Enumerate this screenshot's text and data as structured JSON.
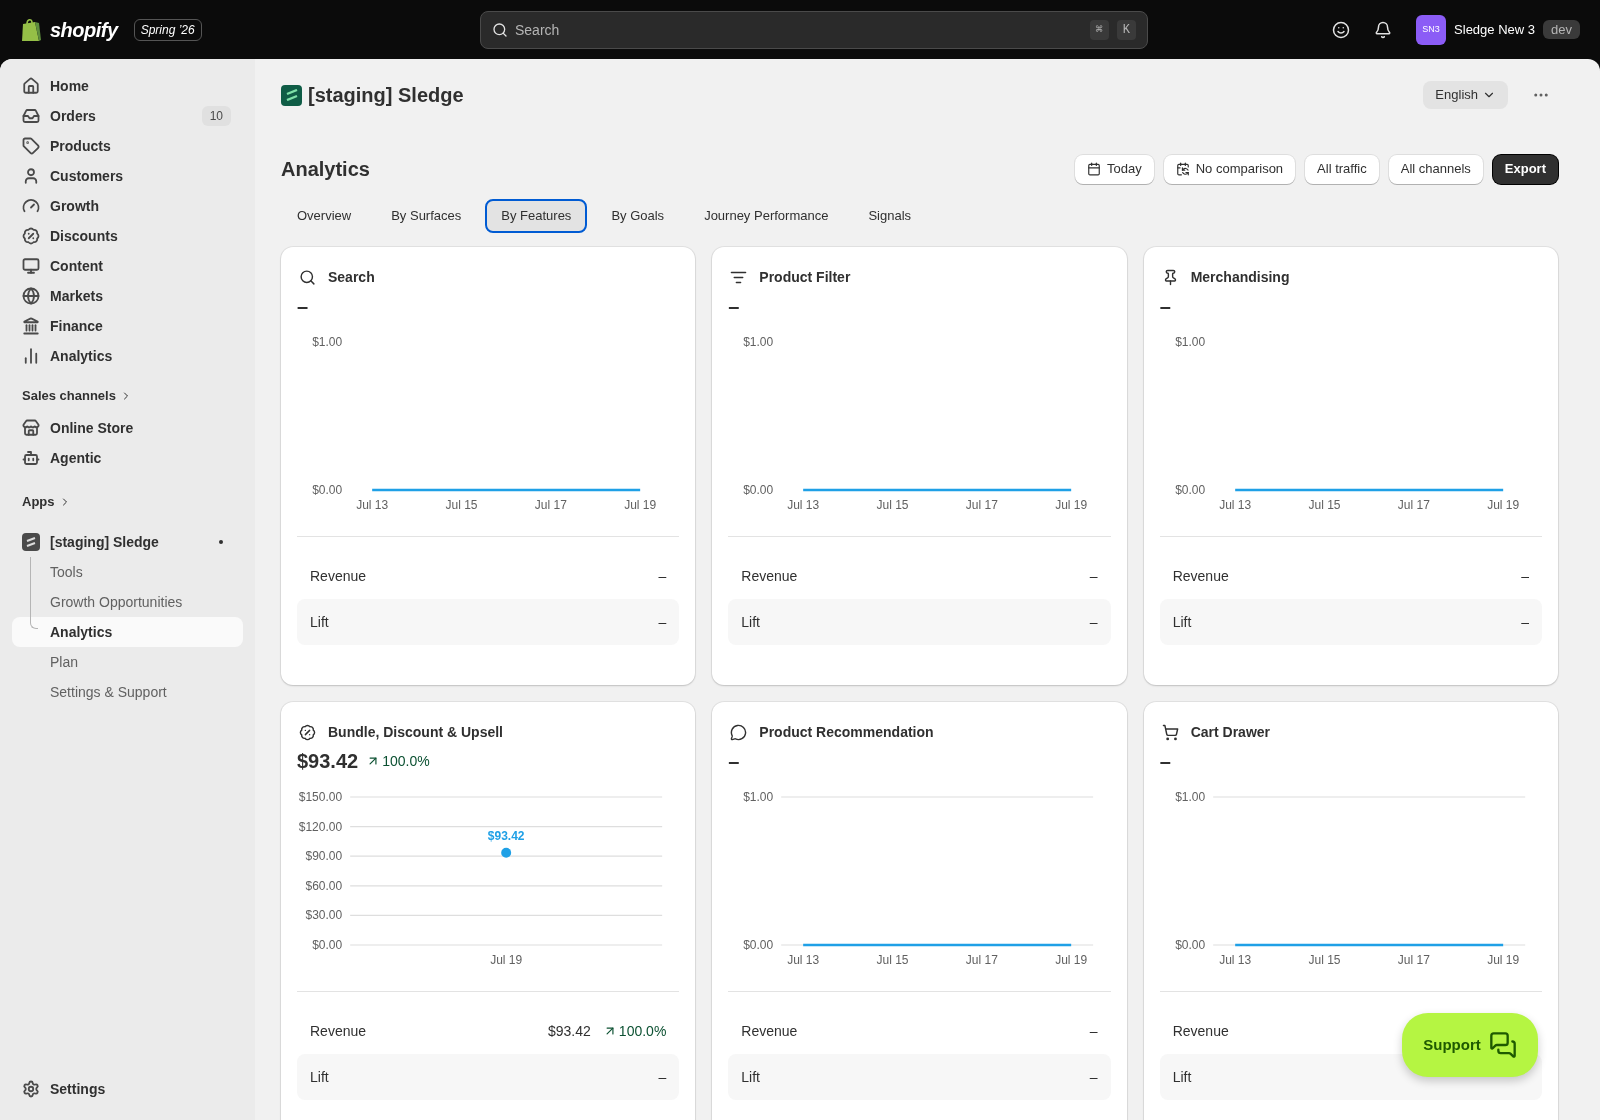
{
  "top_bar": {
    "brand": "shopify",
    "edition": "Spring ’26",
    "search": {
      "placeholder": "Search",
      "shortcut": [
        "⌘",
        "K"
      ]
    },
    "store": {
      "initials": "SN3",
      "name": "Sledge New 3",
      "badge": "dev"
    }
  },
  "sidebar": {
    "items": [
      {
        "label": "Home",
        "selected": false
      },
      {
        "label": "Orders",
        "badge": "10",
        "selected": false
      },
      {
        "label": "Products",
        "selected": false
      },
      {
        "label": "Customers",
        "selected": false
      },
      {
        "label": "Growth",
        "selected": false
      },
      {
        "label": "Discounts",
        "selected": false
      },
      {
        "label": "Content",
        "selected": false
      },
      {
        "label": "Markets",
        "selected": false
      },
      {
        "label": "Finance",
        "selected": false
      },
      {
        "label": "Analytics",
        "selected": false
      }
    ],
    "sales_channels": {
      "title": "Sales channels",
      "items": [
        {
          "label": "Online Store",
          "selected": false
        },
        {
          "label": "Agentic",
          "selected": false
        }
      ]
    },
    "apps": {
      "title": "Apps",
      "app": {
        "label": "[staging] Sledge",
        "children": [
          {
            "label": "Tools",
            "selected": false
          },
          {
            "label": "Growth Opportunities",
            "selected": false
          },
          {
            "label": "Analytics",
            "selected": true
          },
          {
            "label": "Plan",
            "selected": false
          },
          {
            "label": "Settings & Support",
            "selected": false
          }
        ]
      }
    },
    "footer": {
      "label": "Settings"
    }
  },
  "header": {
    "app_title": "[staging] Sledge",
    "language": "English"
  },
  "analytics": {
    "title": "Analytics",
    "filters": [
      "Today",
      "No comparison",
      "All traffic",
      "All channels"
    ],
    "export": "Export",
    "tabs": [
      {
        "label": "Overview",
        "selected": false
      },
      {
        "label": "By Surfaces",
        "selected": false
      },
      {
        "label": "By Features",
        "selected": true
      },
      {
        "label": "By Goals",
        "selected": false
      },
      {
        "label": "Journey Performance",
        "selected": false
      },
      {
        "label": "Signals",
        "selected": false
      }
    ],
    "cards": [
      {
        "title": "Search",
        "total": "–",
        "chart_data": {
          "type": "line",
          "categories": [
            "Jul 13",
            null,
            "Jul 15",
            null,
            "Jul 17",
            null,
            "Jul 19"
          ],
          "ylim": [
            0,
            1
          ],
          "yticks": [
            {
              "value": 0,
              "label": "$0.00"
            },
            {
              "value": 1,
              "label": "$1.00"
            }
          ],
          "series": [
            {
              "color": "#1fa0e6",
              "values": [
                0,
                0,
                0,
                0,
                0,
                0,
                0
              ]
            }
          ]
        },
        "metrics": [
          {
            "label": "Revenue",
            "value": "–"
          },
          {
            "label": "Lift",
            "value": "–"
          }
        ]
      },
      {
        "title": "Product Filter",
        "total": "–",
        "chart_data": {
          "type": "line",
          "categories": [
            "Jul 13",
            null,
            "Jul 15",
            null,
            "Jul 17",
            null,
            "Jul 19"
          ],
          "ylim": [
            0,
            1
          ],
          "yticks": [
            {
              "value": 0,
              "label": "$0.00"
            },
            {
              "value": 1,
              "label": "$1.00"
            }
          ],
          "series": [
            {
              "color": "#1fa0e6",
              "values": [
                0,
                0,
                0,
                0,
                0,
                0,
                0
              ]
            }
          ]
        },
        "metrics": [
          {
            "label": "Revenue",
            "value": "–"
          },
          {
            "label": "Lift",
            "value": "–"
          }
        ]
      },
      {
        "title": "Merchandising",
        "total": "–",
        "chart_data": {
          "type": "line",
          "categories": [
            "Jul 13",
            null,
            "Jul 15",
            null,
            "Jul 17",
            null,
            "Jul 19"
          ],
          "ylim": [
            0,
            1
          ],
          "yticks": [
            {
              "value": 0,
              "label": "$0.00"
            },
            {
              "value": 1,
              "label": "$1.00"
            }
          ],
          "series": [
            {
              "color": "#1fa0e6",
              "values": [
                0,
                0,
                0,
                0,
                0,
                0,
                0
              ]
            }
          ]
        },
        "metrics": [
          {
            "label": "Revenue",
            "value": "–"
          },
          {
            "label": "Lift",
            "value": "–"
          }
        ]
      },
      {
        "title": "Bundle, Discount & Upsell",
        "total": "$93.42",
        "change": "100.0%",
        "chart_data": {
          "type": "scatter",
          "grid": true,
          "categories": [
            "Jul 19"
          ],
          "ylim": [
            0,
            150
          ],
          "yticks": [
            {
              "value": 0,
              "label": "$0.00"
            },
            {
              "value": 30,
              "label": "$30.00"
            },
            {
              "value": 60,
              "label": "$60.00"
            },
            {
              "value": 90,
              "label": "$90.00"
            },
            {
              "value": 120,
              "label": "$120.00"
            },
            {
              "value": 150,
              "label": "$150.00"
            }
          ],
          "series": [
            {
              "color": "#1fa0e6",
              "values": [
                93.42
              ]
            }
          ],
          "value_labels": [
            "$93.42"
          ]
        },
        "metrics": [
          {
            "label": "Revenue",
            "value": "$93.42",
            "change": "100.0%"
          },
          {
            "label": "Lift",
            "value": "–"
          }
        ]
      },
      {
        "title": "Product Recommendation",
        "total": "–",
        "chart_data": {
          "type": "line",
          "grid": true,
          "categories": [
            "Jul 13",
            null,
            "Jul 15",
            null,
            "Jul 17",
            null,
            "Jul 19"
          ],
          "ylim": [
            0,
            1
          ],
          "yticks": [
            {
              "value": 0,
              "label": "$0.00"
            },
            {
              "value": 1,
              "label": "$1.00"
            }
          ],
          "series": [
            {
              "color": "#1fa0e6",
              "values": [
                0,
                0,
                0,
                0,
                0,
                0,
                0
              ]
            }
          ]
        },
        "metrics": [
          {
            "label": "Revenue",
            "value": "–"
          },
          {
            "label": "Lift",
            "value": "–"
          }
        ]
      },
      {
        "title": "Cart Drawer",
        "total": "–",
        "chart_data": {
          "type": "line",
          "grid": true,
          "categories": [
            "Jul 13",
            null,
            "Jul 15",
            null,
            "Jul 17",
            null,
            "Jul 19"
          ],
          "ylim": [
            0,
            1
          ],
          "yticks": [
            {
              "value": 0,
              "label": "$0.00"
            },
            {
              "value": 1,
              "label": "$1.00"
            }
          ],
          "series": [
            {
              "color": "#1fa0e6",
              "values": [
                0,
                0,
                0,
                0,
                0,
                0,
                0
              ]
            }
          ]
        },
        "metrics": [
          {
            "label": "Revenue"
          },
          {
            "label": "Lift"
          }
        ]
      }
    ]
  },
  "support": {
    "label": "Support"
  }
}
